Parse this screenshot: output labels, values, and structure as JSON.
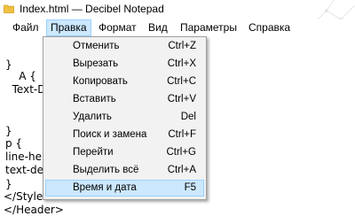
{
  "window": {
    "title": "Index.html — Decibel Notepad"
  },
  "menubar": {
    "items": [
      {
        "label": "Файл"
      },
      {
        "label": "Правка"
      },
      {
        "label": "Формат"
      },
      {
        "label": "Вид"
      },
      {
        "label": "Параметры"
      },
      {
        "label": "Справка"
      }
    ],
    "active": "Правка"
  },
  "edit_menu": {
    "items": [
      {
        "label": "Отменить",
        "shortcut": "Ctrl+Z"
      },
      {
        "label": "Вырезать",
        "shortcut": "Ctrl+X"
      },
      {
        "label": "Копировать",
        "shortcut": "Ctrl+C"
      },
      {
        "label": "Вставить",
        "shortcut": "Ctrl+V"
      },
      {
        "label": "Удалить",
        "shortcut": "Del"
      },
      {
        "label": "Поиск и замена",
        "shortcut": "Ctrl+F"
      },
      {
        "label": "Перейти",
        "shortcut": "Ctrl+G"
      },
      {
        "label": "Выделить всё",
        "shortcut": "Ctrl+A"
      },
      {
        "label": "Время и дата",
        "shortcut": "F5"
      }
    ],
    "highlighted": "Время и дата"
  },
  "editor": {
    "lines": [
      "}",
      "    A {",
      "  Text-De",
      "",
      "",
      "}",
      "p {",
      "line-he",
      "text-de",
      "}",
      "</Style>",
      "</Header>"
    ]
  },
  "colors": {
    "highlight_bg": "#cce8ff",
    "highlight_border": "#99d1ff",
    "menu_bg": "#f2f2f2",
    "folder_icon": "#f0c040"
  }
}
